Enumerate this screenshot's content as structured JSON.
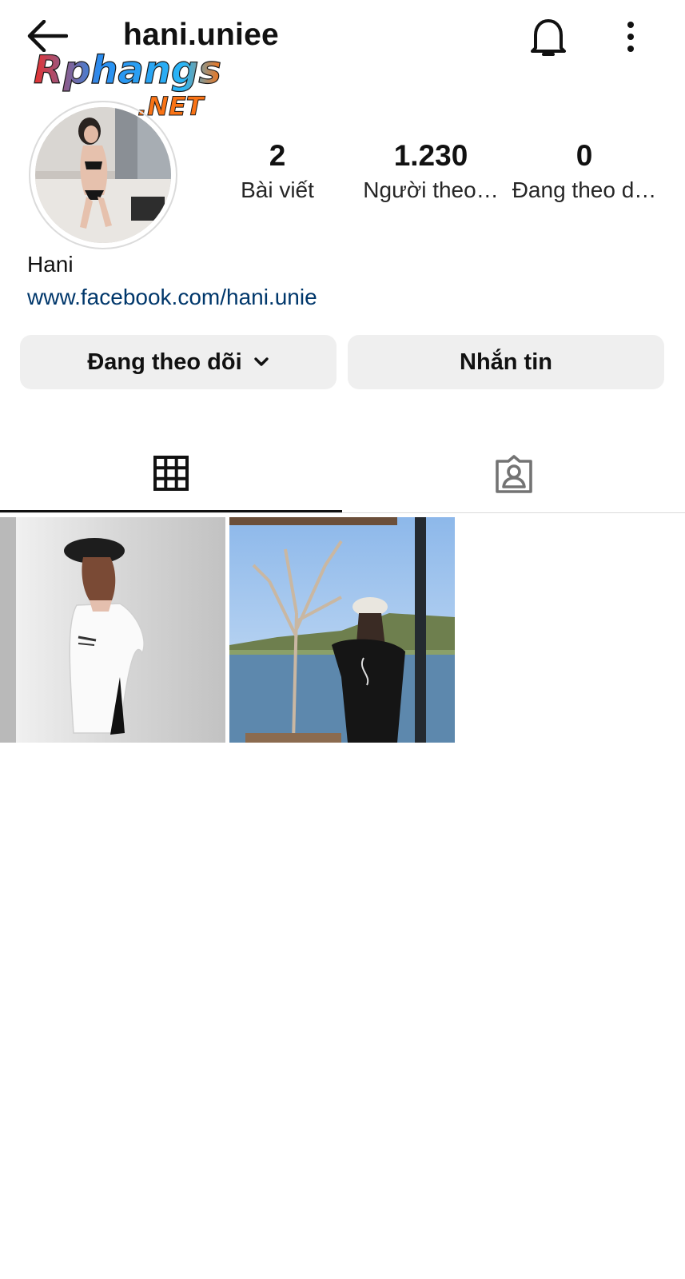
{
  "header": {
    "username": "hani.uniee",
    "icons": {
      "back": "arrow-left-icon",
      "notifications": "bell-icon",
      "more": "more-vertical-icon"
    }
  },
  "watermark": {
    "line1": "Rphangs",
    "line2": ".NET"
  },
  "profile": {
    "stats": [
      {
        "value": "2",
        "label": "Bài viết"
      },
      {
        "value": "1.230",
        "label": "Người theo…"
      },
      {
        "value": "0",
        "label": "Đang theo d…"
      }
    ],
    "name": "Hani",
    "link": "www.facebook.com/hani.unie"
  },
  "actions": {
    "following_label": "Đang theo dõi",
    "message_label": "Nhắn tin"
  },
  "tabs": {
    "active": "grid",
    "items": [
      {
        "id": "grid",
        "icon": "grid-icon"
      },
      {
        "id": "tagged",
        "icon": "tagged-person-icon"
      }
    ]
  },
  "posts": [
    {
      "description": "woman-in-white-shirt-photo"
    },
    {
      "description": "woman-by-lake-photo"
    }
  ],
  "colors": {
    "link": "#00376b",
    "button_bg": "#efefef",
    "divider": "#dbdbdb"
  }
}
